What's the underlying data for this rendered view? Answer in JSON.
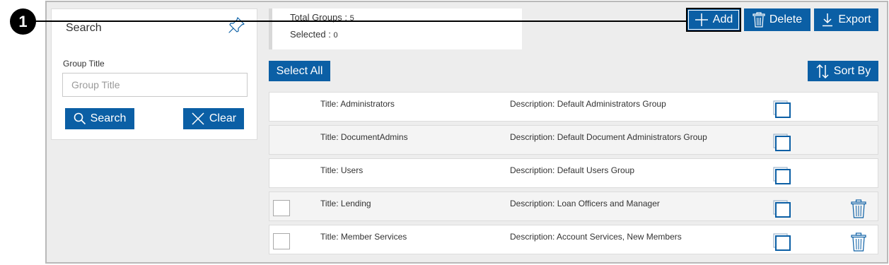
{
  "callout": {
    "number": "1"
  },
  "search_panel": {
    "title": "Search",
    "field_label": "Group Title",
    "field_placeholder": "Group Title",
    "search_label": "Search",
    "clear_label": "Clear"
  },
  "summary": {
    "total_label": "Total Groups :",
    "total_value": "5",
    "selected_label": "Selected :",
    "selected_value": "0"
  },
  "toolbar": {
    "add_label": "Add",
    "delete_label": "Delete",
    "export_label": "Export",
    "select_all_label": "Select All",
    "sort_by_label": "Sort By"
  },
  "colors": {
    "accent": "#0b5fa5",
    "icon_blue": "#0b5fa5",
    "panel_bg": "#ededed"
  },
  "groups": [
    {
      "title": "Title:  Administrators",
      "description": "Description:  Default Administrators Group",
      "has_checkbox": false,
      "has_delete": false
    },
    {
      "title": "Title:  DocumentAdmins",
      "description": "Description:  Default Document Administrators Group",
      "has_checkbox": false,
      "has_delete": false
    },
    {
      "title": "Title:  Users",
      "description": "Description:  Default Users Group",
      "has_checkbox": false,
      "has_delete": false
    },
    {
      "title": "Title:  Lending",
      "description": "Description:  Loan Officers and Manager",
      "has_checkbox": true,
      "has_delete": true
    },
    {
      "title": "Title:  Member Services",
      "description": "Description:  Account Services, New Members",
      "has_checkbox": true,
      "has_delete": true
    }
  ]
}
